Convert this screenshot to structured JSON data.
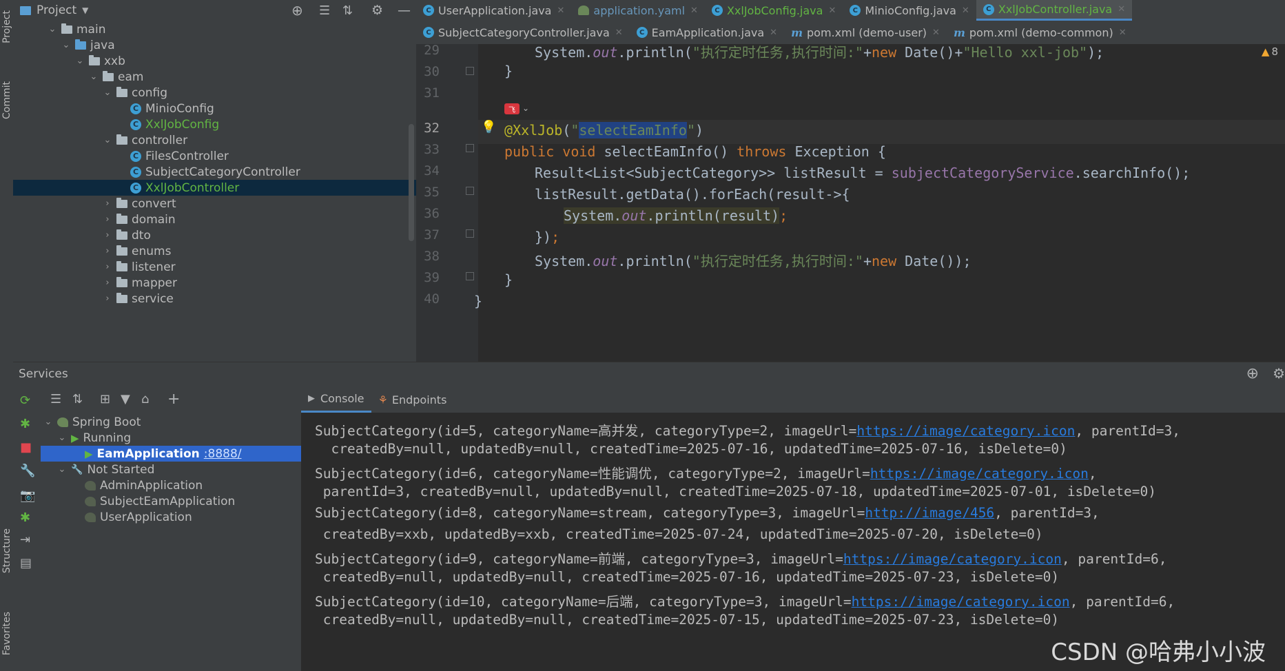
{
  "left_strip": {
    "tabs": [
      "Project",
      "Commit",
      "Structure",
      "Favorites"
    ]
  },
  "project": {
    "title": "Project",
    "tree": [
      {
        "label": "main",
        "depth": 3,
        "kind": "folder",
        "expanded": true
      },
      {
        "label": "java",
        "depth": 4,
        "kind": "folder-blue",
        "expanded": true
      },
      {
        "label": "xxb",
        "depth": 5,
        "kind": "folder",
        "expanded": true
      },
      {
        "label": "eam",
        "depth": 6,
        "kind": "folder",
        "expanded": true
      },
      {
        "label": "config",
        "depth": 7,
        "kind": "folder",
        "expanded": true
      },
      {
        "label": "MinioConfig",
        "depth": 8,
        "kind": "class"
      },
      {
        "label": "XxlJobConfig",
        "depth": 8,
        "kind": "class",
        "green": true
      },
      {
        "label": "controller",
        "depth": 7,
        "kind": "folder",
        "expanded": true
      },
      {
        "label": "FilesController",
        "depth": 8,
        "kind": "class"
      },
      {
        "label": "SubjectCategoryController",
        "depth": 8,
        "kind": "class"
      },
      {
        "label": "XxlJobController",
        "depth": 8,
        "kind": "class",
        "green": true,
        "selected": true
      },
      {
        "label": "convert",
        "depth": 7,
        "kind": "folder",
        "expanded": false
      },
      {
        "label": "domain",
        "depth": 7,
        "kind": "folder",
        "expanded": false
      },
      {
        "label": "dto",
        "depth": 7,
        "kind": "folder",
        "expanded": false
      },
      {
        "label": "enums",
        "depth": 7,
        "kind": "folder",
        "expanded": false
      },
      {
        "label": "listener",
        "depth": 7,
        "kind": "folder",
        "expanded": false
      },
      {
        "label": "mapper",
        "depth": 7,
        "kind": "folder",
        "expanded": false
      },
      {
        "label": "service",
        "depth": 7,
        "kind": "folder",
        "expanded": false
      }
    ]
  },
  "tabs_row1": [
    {
      "label": "UserApplication.java",
      "icon": "c"
    },
    {
      "label": "application.yaml",
      "icon": "yaml"
    },
    {
      "label": "XxlJobConfig.java",
      "icon": "c",
      "green": true
    },
    {
      "label": "MinioConfig.java",
      "icon": "c"
    },
    {
      "label": "XxlJobController.java",
      "icon": "c",
      "green": true,
      "active": true
    }
  ],
  "tabs_row2": [
    {
      "label": "SubjectCategoryController.java",
      "icon": "c"
    },
    {
      "label": "EamApplication.java",
      "icon": "c"
    },
    {
      "label": "pom.xml (demo-user)",
      "icon": "m"
    },
    {
      "label": "pom.xml (demo-common)",
      "icon": "m"
    }
  ],
  "editor": {
    "warning_count": "8",
    "line_numbers": [
      "29",
      "30",
      "31",
      "32",
      "33",
      "34",
      "35",
      "36",
      "37",
      "38",
      "39",
      "40"
    ],
    "current_line": "32"
  },
  "services": {
    "title": "Services",
    "tree": [
      {
        "label": "Spring Boot",
        "depth": 0,
        "kind": "spring"
      },
      {
        "label": "Running",
        "depth": 1,
        "kind": "running"
      },
      {
        "label": "EamApplication",
        "port": ":8888/",
        "depth": 2,
        "kind": "app-running",
        "selected": true
      },
      {
        "label": "Not Started",
        "depth": 1,
        "kind": "not-started"
      },
      {
        "label": "AdminApplication",
        "depth": 2,
        "kind": "app"
      },
      {
        "label": "SubjectEamApplication",
        "depth": 2,
        "kind": "app"
      },
      {
        "label": "UserApplication",
        "depth": 2,
        "kind": "app"
      }
    ]
  },
  "console_tabs": {
    "console": "Console",
    "endpoints": "Endpoints"
  },
  "console_lines": [
    [
      {
        "t": "SubjectCategory(id=5, categoryName=高并发, categoryType=2, imageUrl="
      },
      {
        "t": "https://image/category.icon",
        "link": true
      },
      {
        "t": ", parentId=3,"
      }
    ],
    [
      {
        "t": "  createdBy=null, updatedBy=null, createdTime=2025-07-16, updatedTime=2025-07-16, isDelete=0)"
      }
    ],
    [
      {
        "t": "SubjectCategory(id=6, categoryName=性能调优, categoryType=2, imageUrl="
      },
      {
        "t": "https://image/category.icon",
        "link": true
      },
      {
        "t": ","
      }
    ],
    [
      {
        "t": " parentId=3, createdBy=null, updatedBy=null, createdTime=2025-07-18, updatedTime=2025-07-01, isDelete=0)"
      }
    ],
    [
      {
        "t": "SubjectCategory(id=8, categoryName=stream, categoryType=3, imageUrl="
      },
      {
        "t": "http://image/456",
        "link": true
      },
      {
        "t": ", parentId=3,"
      }
    ],
    [
      {
        "t": " createdBy=xxb, updatedBy=xxb, createdTime=2025-07-24, updatedTime=2025-07-20, isDelete=0)"
      }
    ],
    [
      {
        "t": "SubjectCategory(id=9, categoryName=前端, categoryType=3, imageUrl="
      },
      {
        "t": "https://image/category.icon",
        "link": true
      },
      {
        "t": ", parentId=6,"
      }
    ],
    [
      {
        "t": " createdBy=null, updatedBy=null, createdTime=2025-07-16, updatedTime=2025-07-23, isDelete=0)"
      }
    ],
    [
      {
        "t": "SubjectCategory(id=10, categoryName=后端, categoryType=3, imageUrl="
      },
      {
        "t": "https://image/category.icon",
        "link": true
      },
      {
        "t": ", parentId=6,"
      }
    ],
    [
      {
        "t": " createdBy=null, updatedBy=null, createdTime=2025-07-15, updatedTime=2025-07-23, isDelete=0)"
      }
    ]
  ],
  "watermark": "CSDN @哈弗小小波"
}
